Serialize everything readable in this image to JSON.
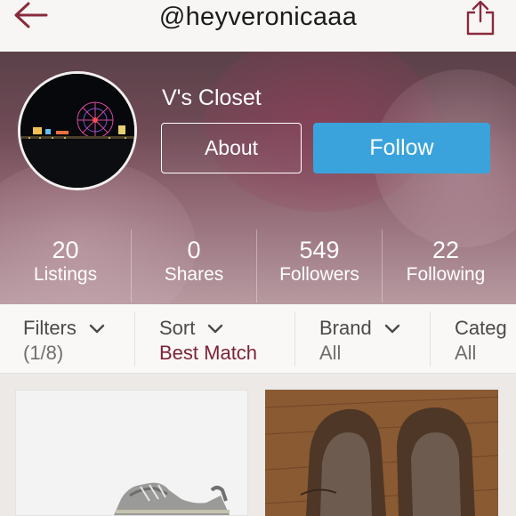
{
  "header": {
    "title": "@heyveronicaaa",
    "back_icon": "back-arrow-icon",
    "share_icon": "share-icon"
  },
  "profile": {
    "closet_name": "V's Closet",
    "about_label": "About",
    "follow_label": "Follow"
  },
  "stats": [
    {
      "value": "20",
      "label": "Listings"
    },
    {
      "value": "0",
      "label": "Shares"
    },
    {
      "value": "549",
      "label": "Followers"
    },
    {
      "value": "22",
      "label": "Following"
    }
  ],
  "filters": [
    {
      "name": "Filters",
      "value": "(1/8)"
    },
    {
      "name": "Sort",
      "value": "Best Match"
    },
    {
      "name": "Brand",
      "value": "All"
    },
    {
      "name": "Categ",
      "value": "All"
    }
  ],
  "colors": {
    "accent": "#7b2337",
    "follow_button": "#3aa3dc",
    "back_arrow": "#8a2a3c"
  }
}
